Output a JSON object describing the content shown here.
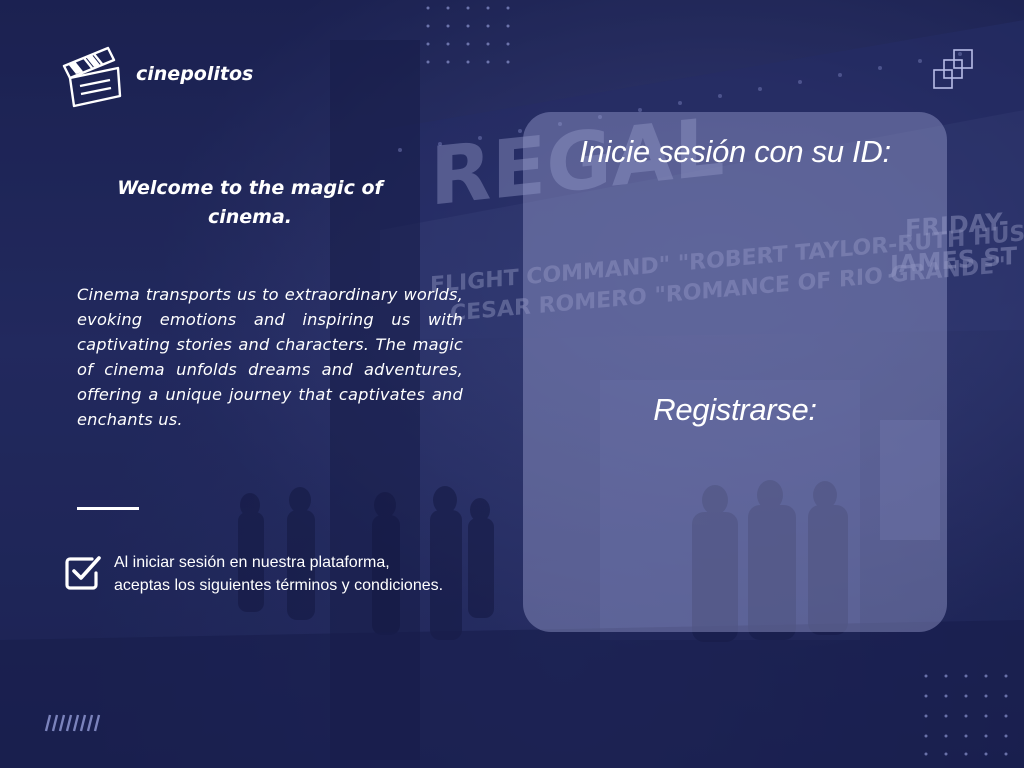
{
  "brand": {
    "name": "cinepolitos",
    "logo_icon": "clapperboard-icon"
  },
  "hero": {
    "heading": "Welcome to the magic of cinema.",
    "description": "Cinema transports us to extraordinary worlds, evoking emotions and inspiring us with captivating stories and characters. The magic of cinema unfolds dreams and adventures, offering a unique journey that captivates and enchants us."
  },
  "terms": {
    "checkbox_icon": "checkbox-checked-icon",
    "line1": "Al iniciar sesión en nuestra plataforma,",
    "line2": "aceptas los siguientes términos y condiciones."
  },
  "login": {
    "title": "Inicie sesión con su ID:",
    "register_label": "Registrarse:"
  },
  "background": {
    "marquee_text": "REGAL",
    "sign_line1": "FLIGHT COMMAND\" \"ROBERT TAYLOR-RUTH HUSSEY",
    "sign_line2": "CESAR ROMERO \"ROMANCE OF RIO GRANDE\"",
    "side_sign1": "FRIDAY-",
    "side_sign2": "JAMES ST"
  },
  "colors": {
    "background": "#1e2556",
    "card": "#969bcd",
    "text": "#ffffff"
  }
}
